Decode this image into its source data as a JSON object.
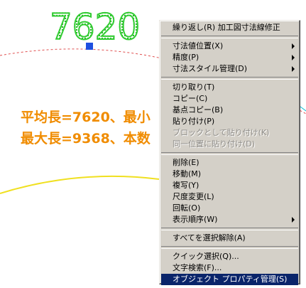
{
  "canvas": {
    "dimension_value": "7620",
    "line1": "平均長=7620、最小",
    "line2": "最大長=9368、本数",
    "colors": {
      "dimension": "#33cc33",
      "text": "#f08c00",
      "arc_dashed": "#e05050",
      "arc_yellow": "#f0e020",
      "grip": "#1f4fe0",
      "stray_line": "#00bcd4"
    }
  },
  "context_menu": {
    "items": [
      {
        "label": "繰り返し(R) 加工図寸法線修正",
        "disabled": false,
        "submenu": false,
        "selected": false
      },
      {
        "separator": true
      },
      {
        "label": "寸法値位置(X)",
        "disabled": false,
        "submenu": true,
        "selected": false
      },
      {
        "label": "精度(P)",
        "disabled": false,
        "submenu": true,
        "selected": false
      },
      {
        "label": "寸法スタイル管理(D)",
        "disabled": false,
        "submenu": true,
        "selected": false
      },
      {
        "separator": true
      },
      {
        "label": "切り取り(T)",
        "disabled": false,
        "submenu": false,
        "selected": false
      },
      {
        "label": "コピー(C)",
        "disabled": false,
        "submenu": false,
        "selected": false
      },
      {
        "label": "基点コピー(B)",
        "disabled": false,
        "submenu": false,
        "selected": false
      },
      {
        "label": "貼り付け(P)",
        "disabled": false,
        "submenu": false,
        "selected": false
      },
      {
        "label": "ブロックとして貼り付け(K)",
        "disabled": true,
        "submenu": false,
        "selected": false
      },
      {
        "label": "同一位置に貼り付け(D)",
        "disabled": true,
        "submenu": false,
        "selected": false
      },
      {
        "separator": true
      },
      {
        "label": "削除(E)",
        "disabled": false,
        "submenu": false,
        "selected": false
      },
      {
        "label": "移動(M)",
        "disabled": false,
        "submenu": false,
        "selected": false
      },
      {
        "label": "複写(Y)",
        "disabled": false,
        "submenu": false,
        "selected": false
      },
      {
        "label": "尺度変更(L)",
        "disabled": false,
        "submenu": false,
        "selected": false
      },
      {
        "label": "回転(O)",
        "disabled": false,
        "submenu": false,
        "selected": false
      },
      {
        "label": "表示順序(W)",
        "disabled": false,
        "submenu": true,
        "selected": false
      },
      {
        "separator": true
      },
      {
        "label": "すべてを選択解除(A)",
        "disabled": false,
        "submenu": false,
        "selected": false
      },
      {
        "separator": true
      },
      {
        "label": "クイック選択(Q)...",
        "disabled": false,
        "submenu": false,
        "selected": false
      },
      {
        "label": "文字検索(F)...",
        "disabled": false,
        "submenu": false,
        "selected": false
      },
      {
        "label": "オブジェクト プロパティ管理(S)",
        "disabled": false,
        "submenu": false,
        "selected": true
      }
    ]
  }
}
